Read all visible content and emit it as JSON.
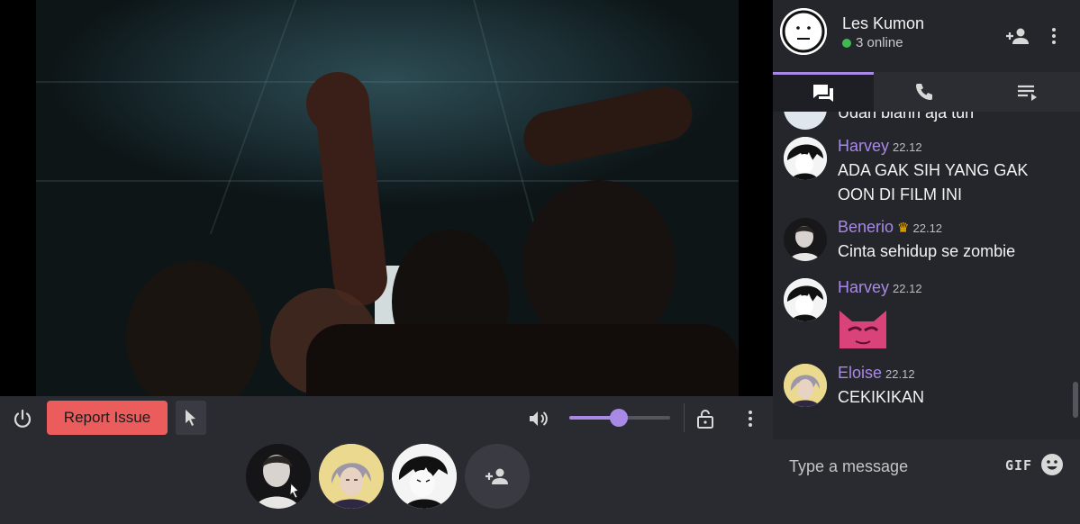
{
  "controls": {
    "report_label": "Report Issue",
    "volume_level": 0.49
  },
  "room": {
    "name": "Les Kumon",
    "online": "3 online"
  },
  "messages": [
    {
      "name": "",
      "time": "",
      "text": "Udah biarin aja tuh"
    },
    {
      "name": "Harvey",
      "time": "22.12",
      "text": "ADA GAK SIH YANG GAK OON DI FILM INI"
    },
    {
      "name": "Benerio",
      "time": "22.12",
      "text": "Cinta sehidup se zombie",
      "badge": "crown"
    },
    {
      "name": "Harvey",
      "time": "22.12",
      "text": ""
    },
    {
      "name": "Eloise",
      "time": "22.12",
      "text": "CEKIKIKAN"
    }
  ],
  "composer": {
    "placeholder": "Type a message",
    "gif_label": "GIF"
  },
  "colors": {
    "accent": "#a88ae6",
    "report": "#eb5c5c",
    "online": "#3fb950"
  }
}
